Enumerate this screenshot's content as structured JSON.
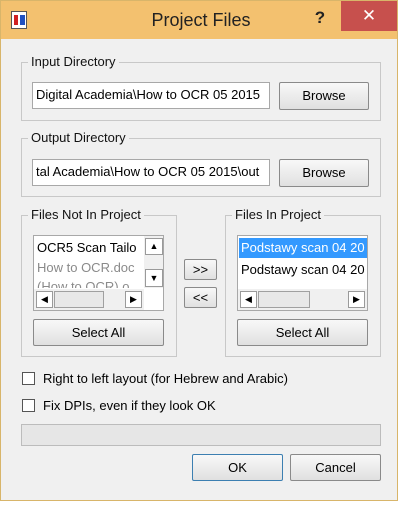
{
  "window": {
    "title": "Project Files",
    "help_glyph": "?",
    "close_glyph": "✕"
  },
  "input_directory": {
    "label": "Input Directory",
    "value": "Digital Academia\\How to OCR 05 2015",
    "button": "Browse"
  },
  "output_directory": {
    "label": "Output Directory",
    "value": "tal Academia\\How to OCR 05 2015\\out",
    "button": "Browse"
  },
  "files_not_in_project": {
    "label": "Files Not In Project",
    "items": [
      "OCR5 Scan Tailo",
      "How to OCR.doc",
      "(How to OCR) o"
    ],
    "select_all": "Select All"
  },
  "transfer": {
    "add_label": ">>",
    "remove_label": "<<"
  },
  "files_in_project": {
    "label": "Files In Project",
    "items": [
      "Podstawy scan 04 20",
      "Podstawy scan 04 20"
    ],
    "select_all": "Select All"
  },
  "options": {
    "rtl_label": "Right to left layout (for Hebrew and Arabic)",
    "rtl_checked": false,
    "fix_dpi_label": "Fix DPIs, even if they look OK",
    "fix_dpi_checked": false
  },
  "progress": {
    "value": 0
  },
  "buttons": {
    "ok": "OK",
    "cancel": "Cancel"
  },
  "colors": {
    "titlebar": "#f3c16f",
    "close": "#c7504d",
    "selection": "#3399ff",
    "disabled_text": "#8a8a8a"
  }
}
